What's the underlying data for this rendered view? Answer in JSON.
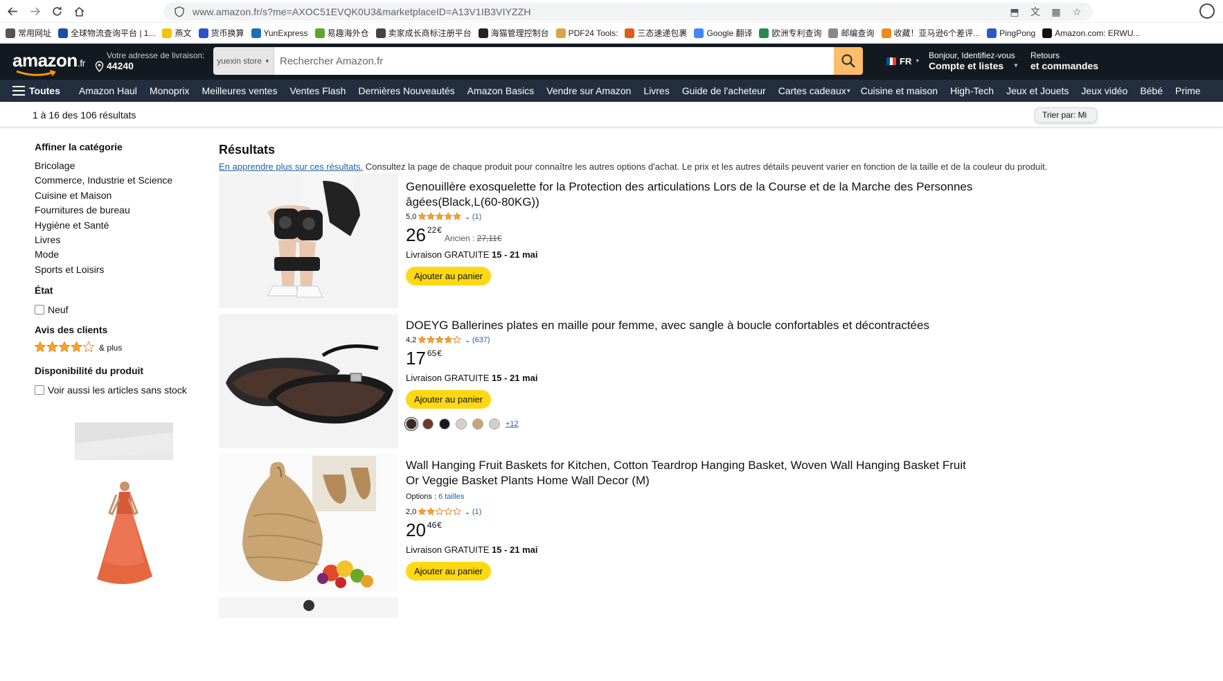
{
  "browser": {
    "url": "www.amazon.fr/s?me=AXOC51EVQK0U3&marketplaceID=A13V1IB3VIYZZH",
    "bookmarks": [
      {
        "label": "常用网址",
        "color": "#555555"
      },
      {
        "label": "全球物流查询平台 | 1...",
        "color": "#1a4fa3"
      },
      {
        "label": "燕文",
        "color": "#f4c400"
      },
      {
        "label": "货币换算",
        "color": "#2a52c9"
      },
      {
        "label": "YunExpress",
        "color": "#1a6fb5"
      },
      {
        "label": "易趣海外仓",
        "color": "#5aa52a"
      },
      {
        "label": "卖家成长商标注册平台",
        "color": "#444444"
      },
      {
        "label": "海猫管理控制台",
        "color": "#222222"
      },
      {
        "label": "PDF24 Tools:",
        "color": "#d9a44a"
      },
      {
        "label": "三态速递包裹",
        "color": "#e05a1a"
      },
      {
        "label": "Google 翻译",
        "color": "#4285f4"
      },
      {
        "label": "欧洲专利查询",
        "color": "#2a8a4a"
      },
      {
        "label": "邮编查询",
        "color": "#888888"
      },
      {
        "label": "收藏！亚马逊6个差评...",
        "color": "#f08a1a"
      },
      {
        "label": "PingPong",
        "color": "#2a5ac9"
      },
      {
        "label": "Amazon.com: ERWU...",
        "color": "#111111"
      }
    ]
  },
  "header": {
    "logo": "amazon",
    "logo_suffix": ".fr",
    "deliver_line1": "Votre adresse de livraison:",
    "deliver_line2": "44240",
    "search_category": "yuexin store",
    "search_placeholder": "Rechercher Amazon.fr",
    "lang": "FR",
    "account_line1": "Bonjour, Identifiez-vous",
    "account_line2": "Compte et listes",
    "returns_line1": "Retours",
    "returns_line2": "et commandes"
  },
  "subnav": {
    "all_label": "Toutes",
    "items": [
      "Amazon Haul",
      "Monoprix",
      "Meilleures ventes",
      "Ventes Flash",
      "Dernières Nouveautés",
      "Amazon Basics",
      "Vendre sur Amazon",
      "Livres",
      "Guide de l'acheteur",
      "Cartes cadeaux",
      "Cuisine et maison",
      "High-Tech",
      "Jeux et Jouets",
      "Jeux vidéo",
      "Bébé",
      "Prime"
    ]
  },
  "results_bar": {
    "count": "1 à 16 des 106 résultats",
    "sort_label": "Trier par:  Mi"
  },
  "sidebar": {
    "category_heading": "Affiner la catégorie",
    "categories": [
      "Bricolage",
      "Commerce, Industrie et Science",
      "Cuisine et Maison",
      "Fournitures de bureau",
      "Hygiène et Santé",
      "Livres",
      "Mode",
      "Sports et Loisirs"
    ],
    "condition_heading": "État",
    "condition_option": "Neuf",
    "reviews_heading": "Avis des clients",
    "reviews_plus": "& plus",
    "reviews_stars": 4,
    "availability_heading": "Disponibilité du produit",
    "availability_option": "Voir aussi les articles sans stock"
  },
  "main": {
    "title": "Résultats",
    "learn_more": "En apprendre plus sur ces résultats.",
    "subtitle": " Consultez la page de chaque produit pour connaître les autres options d'achat. Le prix et les autres détails peuvent varier en fonction de la taille et de la couleur du produit."
  },
  "products": [
    {
      "title": "Genouillère exosquelette for la Protection des articulations Lors de la Course et de la Marche des Personnes âgées(Black,L(60-80KG))",
      "rating_value": "5,0",
      "stars": 5,
      "rating_count": "(1)",
      "price_whole": "26",
      "price_frac": "22",
      "currency": "€",
      "old_label": "Ancien :",
      "old_price": "27,11€",
      "delivery_prefix": "Livraison GRATUITE",
      "delivery_dates": "15 - 21 mai",
      "cart_label": "Ajouter au panier"
    },
    {
      "title": "DOEYG Ballerines plates en maille pour femme, avec sangle à boucle confortables et décontractées",
      "rating_value": "4,2",
      "stars": 4.2,
      "rating_count": "(637)",
      "price_whole": "17",
      "price_frac": "65",
      "currency": "€",
      "delivery_prefix": "Livraison GRATUITE",
      "delivery_dates": "15 - 21 mai",
      "cart_label": "Ajouter au panier",
      "swatch_colors": [
        "#3a2a22",
        "#6b3a2a",
        "#1a1a1a",
        "#d8d0c8",
        "#c9a37a",
        "#cfcfcf"
      ],
      "swatch_more": "+12"
    },
    {
      "title": "Wall Hanging Fruit Baskets for Kitchen, Cotton Teardrop Hanging Basket, Woven Wall Hanging Basket Fruit Or Veggie Basket Plants Home Wall Decor (M)",
      "options_label": "Options : ",
      "options_value": "6 tailles",
      "rating_value": "2,0",
      "stars": 2,
      "rating_count": "(1)",
      "price_whole": "20",
      "price_frac": "46",
      "currency": "€",
      "delivery_prefix": "Livraison GRATUITE",
      "delivery_dates": "15 - 21 mai",
      "cart_label": "Ajouter au panier"
    }
  ],
  "colors": {
    "header_bg": "#131921",
    "subnav_bg": "#232f3e",
    "search_btn": "#febd69",
    "cart_btn": "#ffd814",
    "star": "#ffa41c",
    "link": "#2162a1"
  }
}
